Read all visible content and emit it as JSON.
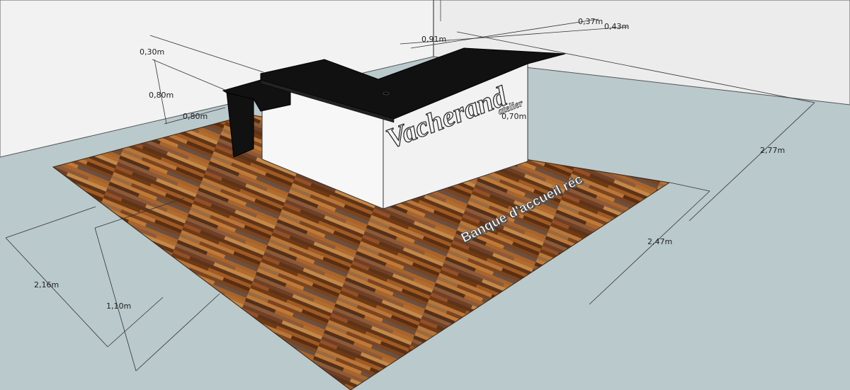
{
  "dimensions": {
    "top_height": "0,30m",
    "counter_height": "0,80m",
    "return_depth": "0,80m",
    "top_width": "0,91m",
    "upper_depth_a": "0,37m",
    "upper_depth_b": "0,43m",
    "front_depth": "0,70m",
    "total_length": "2,77m",
    "floor_depth": "2,47m",
    "floor_width": "2,16m",
    "counter_width": "1,10m"
  },
  "branding": {
    "logo_name": "Vacherand",
    "logo_suffix": "atelier"
  },
  "floor_caption": "Banque d'accueil réc",
  "colors": {
    "sky_wall": "#f2f2f2",
    "ground": "#b9c9cc",
    "counter_top": "#111111",
    "counter_body": "#f7f7f7",
    "wood": "#8a4a1c"
  }
}
